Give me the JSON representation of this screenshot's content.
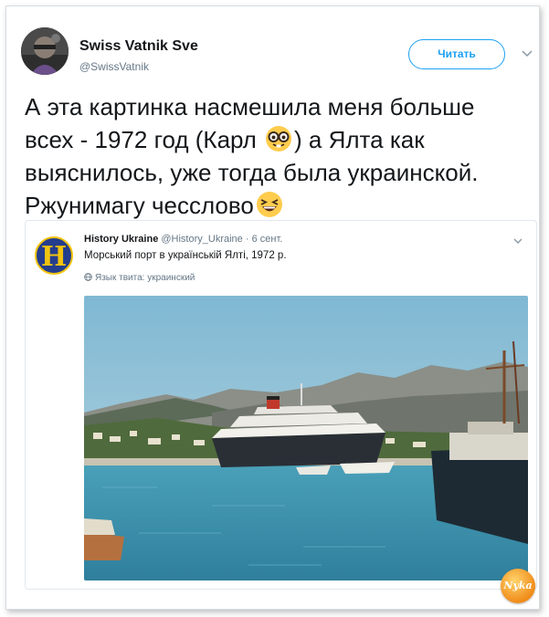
{
  "tweet": {
    "author_name": "Swiss Vatnik Sve",
    "author_handle": "@SwissVatnik",
    "follow_label": "Читать",
    "text_line1": "А эта картинка насмешила меня больше",
    "text_line2a": "всех - 1972 год (Карл ",
    "text_line2b": ") а Ялта как",
    "text_line3": "выяснилось, уже тогда была украинской.",
    "text_line4": "Ржунимагу чесслово",
    "emoji_1": "nerd-face-emoji",
    "emoji_2": "laughing-face-emoji"
  },
  "quoted": {
    "avatar_letter": "H",
    "name": "History Ukraine",
    "handle": "@History_Ukraine",
    "separator": "·",
    "date": "6 сент.",
    "text": "Морський порт в українській Ялті, 1972 р.",
    "language_note": "Язык твита: украинский"
  },
  "watermark": {
    "text": "Nyka"
  },
  "colors": {
    "accent": "#1da1f2",
    "text": "#14171a",
    "muted": "#657786",
    "border": "#e1e8ed"
  }
}
